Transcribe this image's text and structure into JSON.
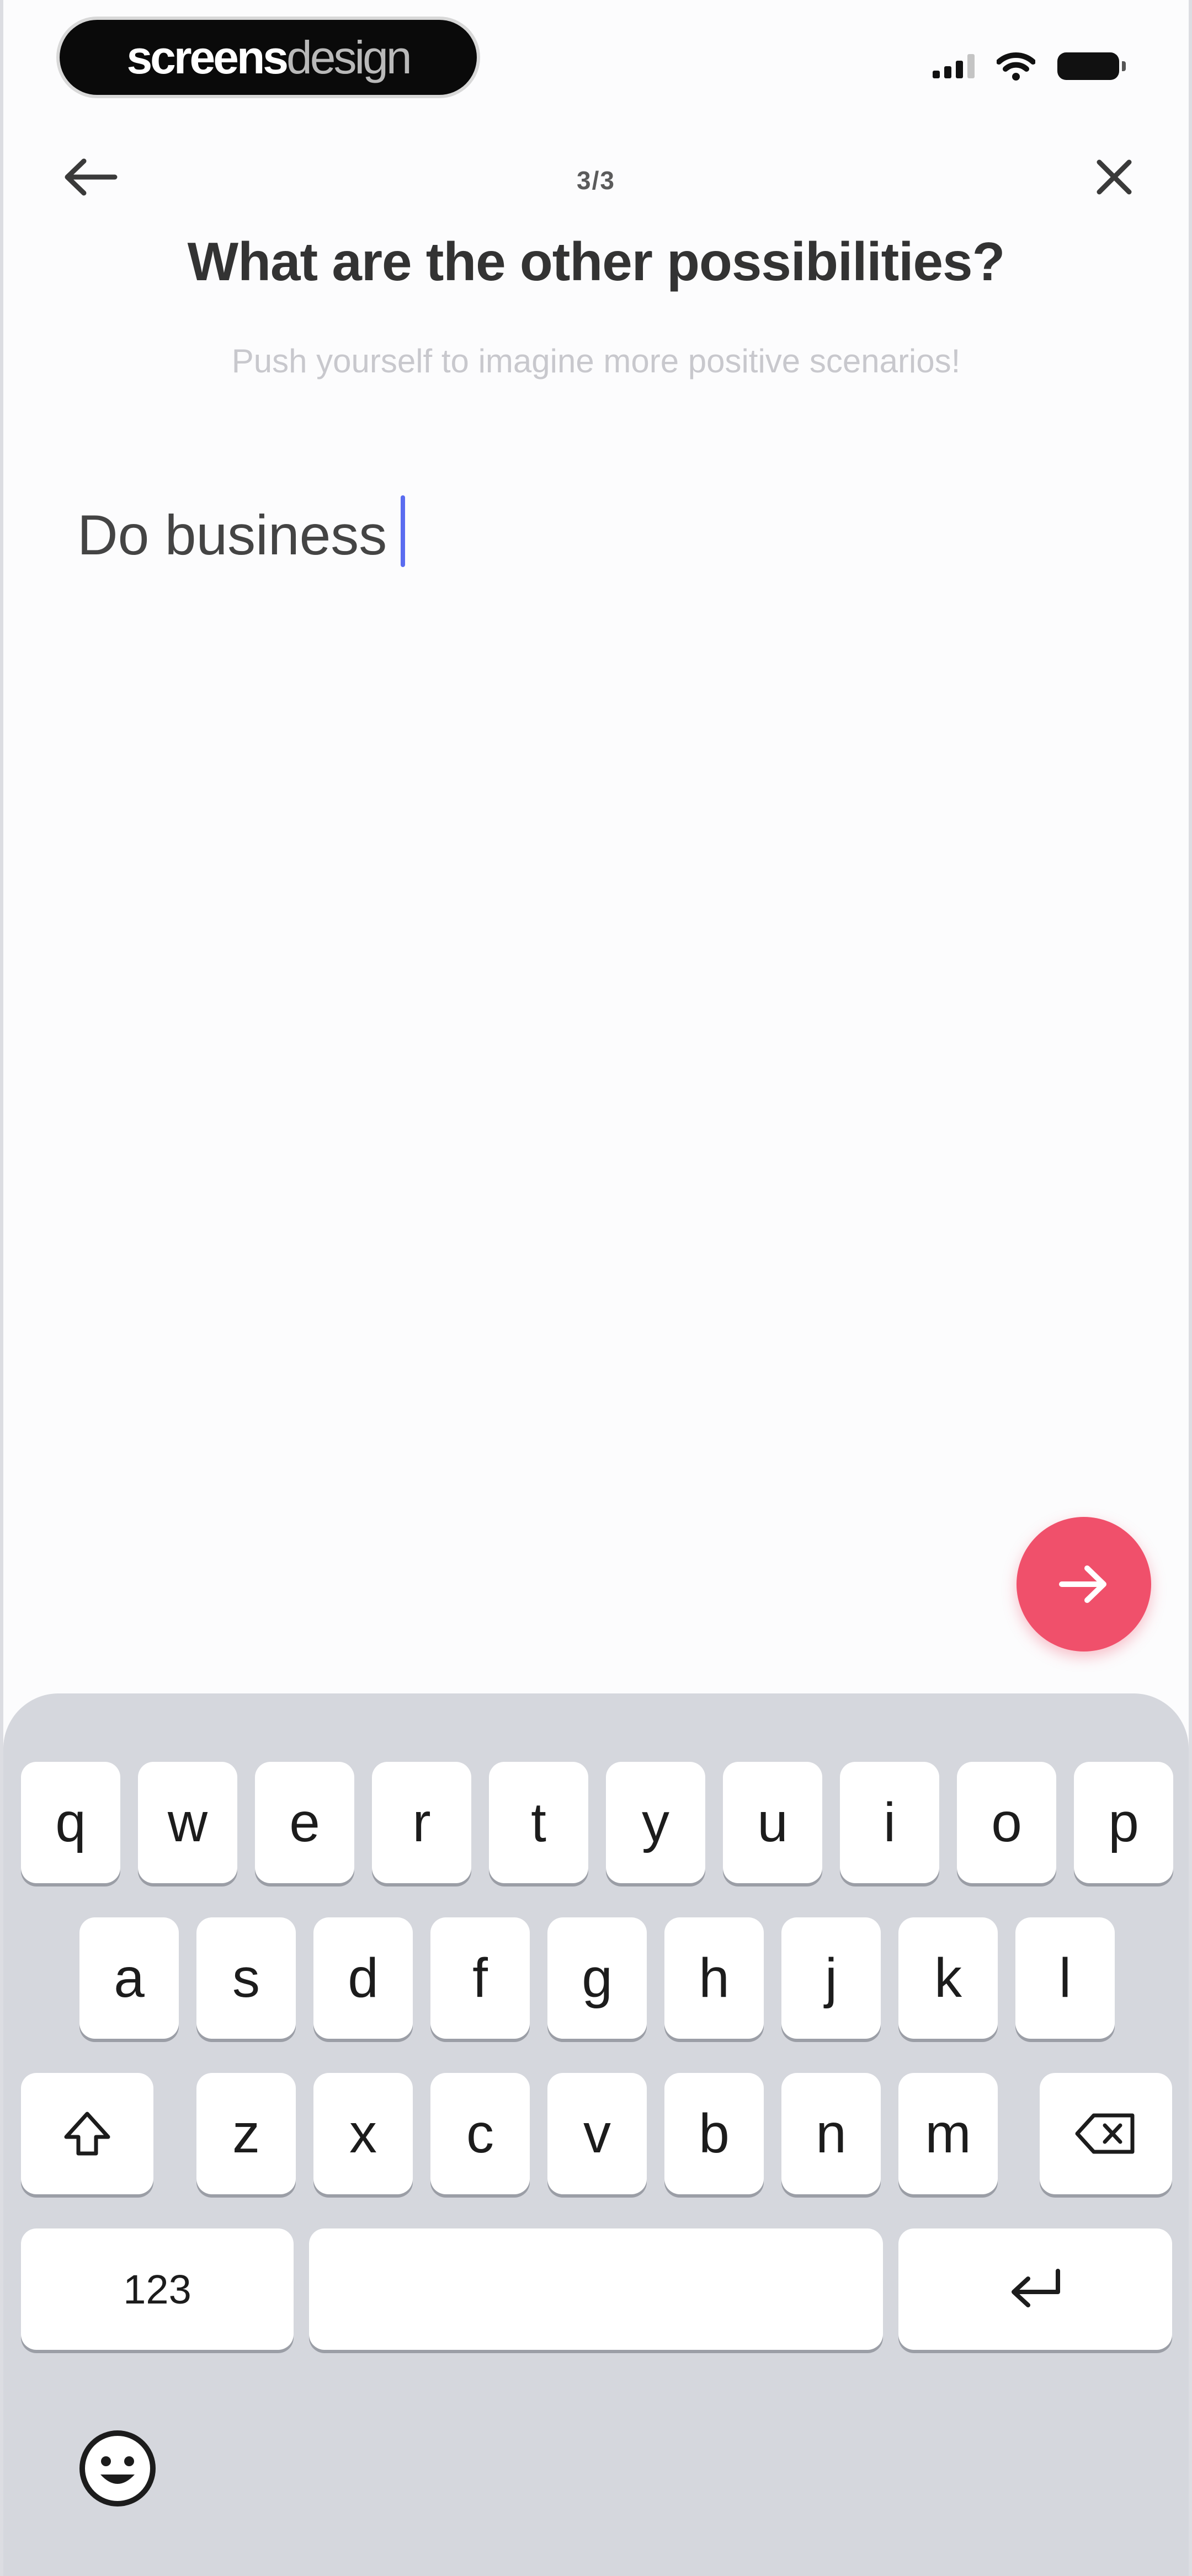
{
  "app": {
    "badge_strong": "screens",
    "badge_light": "design"
  },
  "status_bar": {
    "icons": [
      "signal-icon",
      "wifi-icon",
      "battery-icon"
    ]
  },
  "header": {
    "back_icon": "arrow-left-icon",
    "close_icon": "close-icon",
    "step": "3/3",
    "title": "What are the other possibilities?",
    "subtitle": "Push yourself to imagine more positive scenarios!"
  },
  "entry": {
    "value": "Do business",
    "placeholder": ""
  },
  "actions": {
    "next_icon": "arrow-right-icon",
    "next_color": "#f0506b"
  },
  "keyboard": {
    "row1": [
      "q",
      "w",
      "e",
      "r",
      "t",
      "y",
      "u",
      "i",
      "o",
      "p"
    ],
    "row2": [
      "a",
      "s",
      "d",
      "f",
      "g",
      "h",
      "j",
      "k",
      "l"
    ],
    "row3": [
      "z",
      "x",
      "c",
      "v",
      "b",
      "n",
      "m"
    ],
    "numbers_label": "123",
    "shift_icon": "shift-icon",
    "delete_icon": "backspace-icon",
    "return_icon": "return-icon",
    "emoji_icon": "emoji-icon"
  }
}
